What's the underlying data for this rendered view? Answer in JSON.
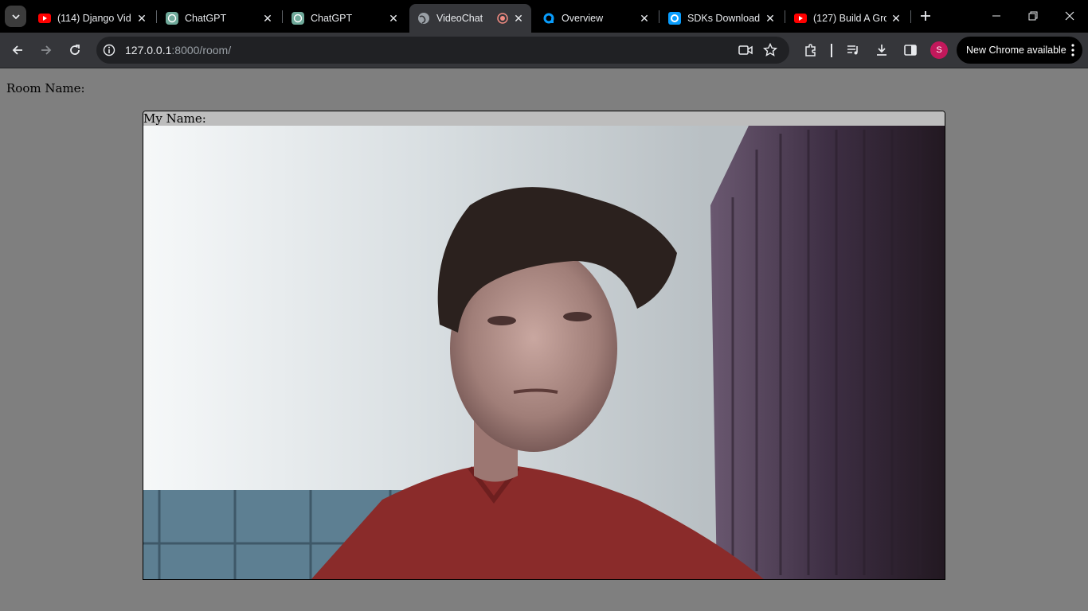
{
  "browser": {
    "tabs": [
      {
        "title": "(114) Django Vid",
        "icon": "youtube-icon"
      },
      {
        "title": "ChatGPT",
        "icon": "chatgpt-icon"
      },
      {
        "title": "ChatGPT",
        "icon": "chatgpt-icon"
      },
      {
        "title": "VideoChat",
        "icon": "globe-icon",
        "active": true
      },
      {
        "title": "Overview",
        "icon": "agora-icon"
      },
      {
        "title": "SDKs Download",
        "icon": "agora-icon"
      },
      {
        "title": "(127) Build A Gro",
        "icon": "youtube-icon"
      }
    ],
    "address": {
      "host": "127.0.0.1",
      "rest": ":8000/room/"
    },
    "profile_initial": "S",
    "update_label": "New Chrome available"
  },
  "page": {
    "room_label": "Room Name:",
    "my_name_label": "My Name:"
  },
  "colors": {
    "tabstrip": "#000000",
    "toolbar": "#35363a",
    "page_bg": "#7f7f7f",
    "youtube_red": "#ff0000",
    "agora_blue": "#099dfd",
    "profile_pink": "#c2185b"
  }
}
